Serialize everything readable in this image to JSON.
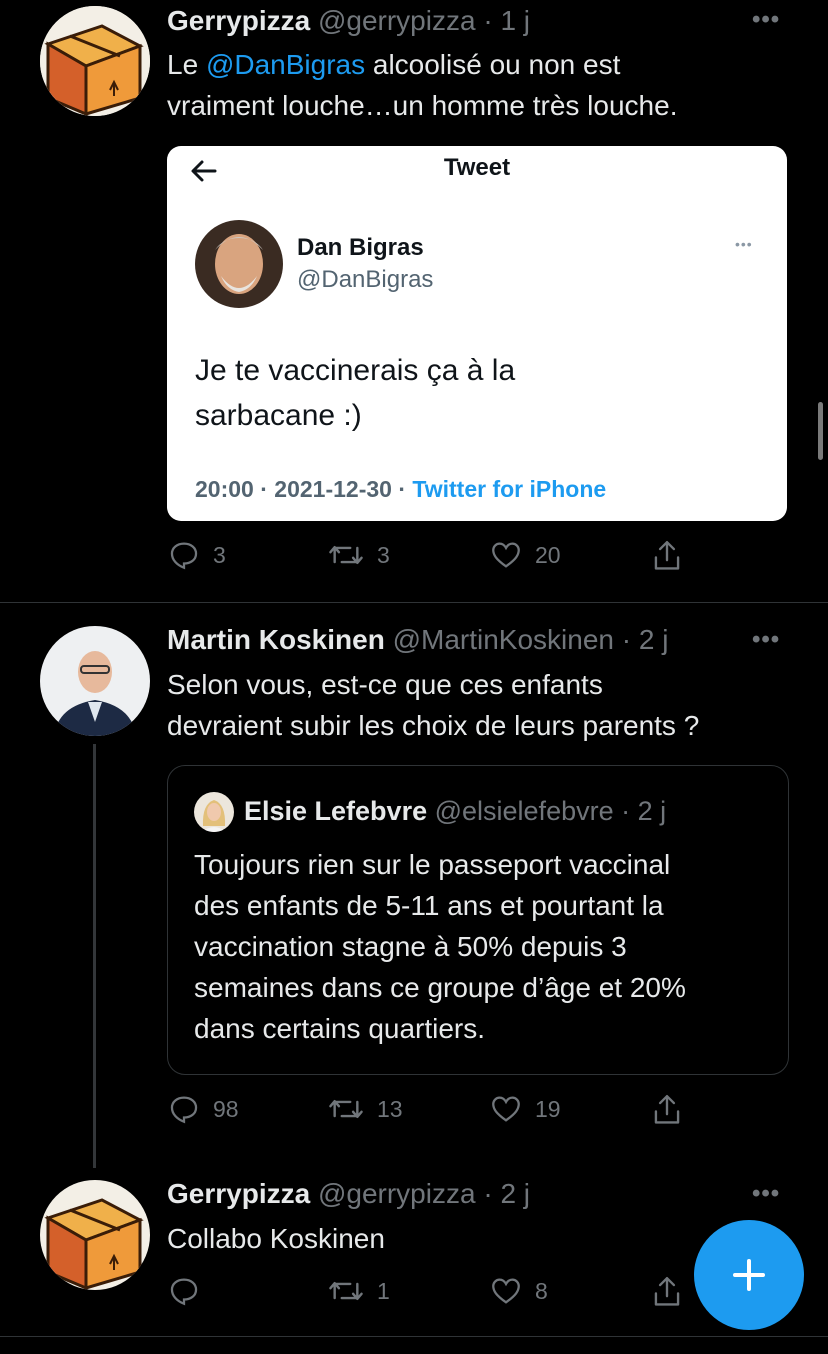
{
  "tweet1": {
    "author": "Gerrypizza",
    "handle": "@gerrypizza",
    "time": "1 j",
    "text_prefix": "Le ",
    "mention": "@DanBigras",
    "text_line1_rest": " alcoolisé ou non est",
    "text_line2": "vraiment louche…un homme très louche.",
    "embedded": {
      "header_title": "Tweet",
      "author": "Dan Bigras",
      "handle": "@DanBigras",
      "text_line1": "Je te vaccinerais ça à la",
      "text_line2": "sarbacane :)",
      "time": "20:00",
      "date": "2021-12-30",
      "client": "Twitter for iPhone"
    },
    "actions": {
      "replies": "3",
      "retweets": "3",
      "likes": "20"
    }
  },
  "tweet2": {
    "author": "Martin Koskinen",
    "handle": "@MartinKoskinen",
    "time": "2 j",
    "text_line1": "Selon vous, est-ce que ces enfants",
    "text_line2": "devraient subir les choix de leurs parents ?",
    "quoted": {
      "author": "Elsie Lefebvre",
      "handle": "@elsielefebvre",
      "time": "2 j",
      "lines": [
        "Toujours rien sur le passeport vaccinal",
        "des enfants de 5-11 ans et pourtant la",
        "vaccination stagne à 50% depuis 3",
        "semaines dans ce groupe d’âge et 20%",
        "dans certains quartiers."
      ]
    },
    "actions": {
      "replies": "98",
      "retweets": "13",
      "likes": "19"
    }
  },
  "tweet3": {
    "author": "Gerrypizza",
    "handle": "@gerrypizza",
    "time": "2 j",
    "text": "Collabo Koskinen",
    "actions": {
      "replies": "",
      "retweets": "1",
      "likes": "8"
    }
  },
  "separator_dot": "·",
  "more_label": "•••",
  "colors": {
    "accent": "#1d9bf0",
    "muted": "#71767b",
    "background": "#000000"
  }
}
